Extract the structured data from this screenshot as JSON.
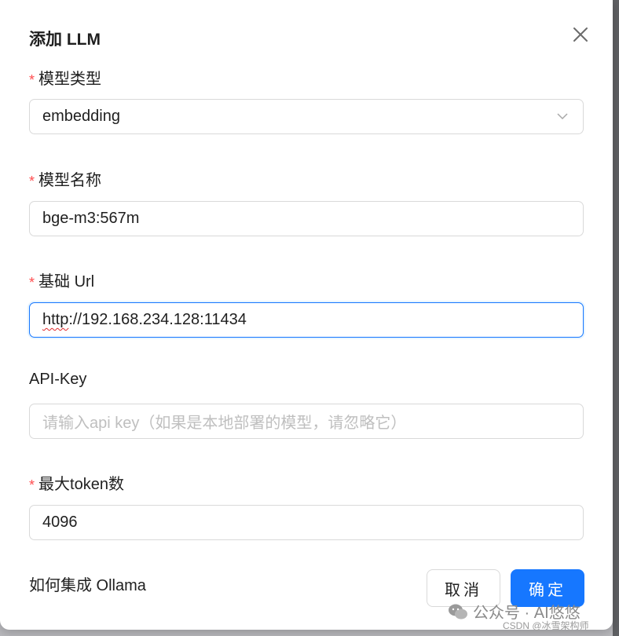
{
  "modal": {
    "title": "添加 LLM"
  },
  "form": {
    "model_type": {
      "label": "模型类型",
      "value": "embedding",
      "required": true
    },
    "model_name": {
      "label": "模型名称",
      "value": "bge-m3:567m",
      "required": true
    },
    "base_url": {
      "label": "基础 Url",
      "value_prefix": "http",
      "value_rest": "://192.168.234.128:11434",
      "required": true
    },
    "api_key": {
      "label": "API-Key",
      "placeholder": "请输入api key（如果是本地部署的模型，请忽略它）",
      "required": false
    },
    "max_tokens": {
      "label": "最大token数",
      "value": "4096",
      "required": true
    }
  },
  "footer": {
    "help_link": "如何集成 Ollama",
    "cancel_label": "取消",
    "ok_label": "确定"
  },
  "watermark": {
    "text": "公众号 · AI悠悠",
    "sub": "CSDN @冰雪架构师"
  },
  "colors": {
    "primary": "#1677ff",
    "required": "#ff4d4f",
    "border": "#d9d9d9"
  },
  "icons": [
    "close-icon",
    "chevron-down-icon",
    "wechat-icon"
  ]
}
